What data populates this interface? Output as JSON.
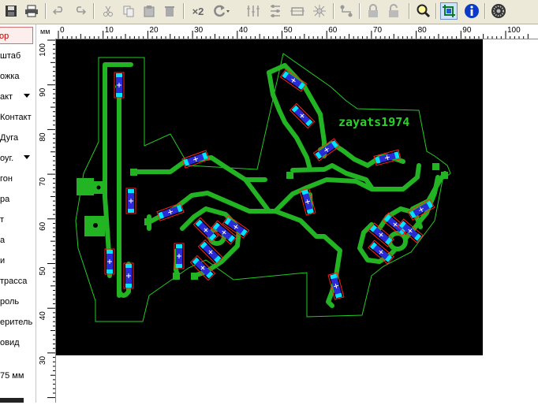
{
  "toolbar": {
    "icons": [
      "save-icon",
      "print-icon",
      "undo-icon",
      "redo-icon",
      "cut-icon",
      "copy-icon",
      "paste-icon",
      "delete-icon",
      "multiply-icon",
      "rotate-icon",
      "mirror-icon",
      "align-icon",
      "group-icon",
      "snap-icon",
      "route-icon",
      "lock-icon",
      "unlock-icon",
      "zoom-icon",
      "connections-icon",
      "info-icon",
      "gear-icon"
    ],
    "multiply_label": "×2"
  },
  "sidebar": {
    "items": [
      {
        "label": "ор",
        "selected": true
      },
      {
        "label": "штаб"
      },
      {
        "label": "ожка"
      },
      {
        "label": "акт",
        "dropdown": true
      },
      {
        "label": "Контакт"
      },
      {
        "label": "Дуга"
      },
      {
        "label": "оуг.",
        "dropdown": true
      },
      {
        "label": "гон"
      },
      {
        "label": "ра"
      },
      {
        "label": "т"
      },
      {
        "label": "а"
      },
      {
        "label": "и"
      },
      {
        "label": "трасса"
      },
      {
        "label": "роль"
      },
      {
        "label": "еритель"
      },
      {
        "label": "овид"
      }
    ],
    "measure": "75 мм"
  },
  "ruler": {
    "unit": "мм",
    "h_ticks": [
      "0",
      "10",
      "20",
      "30",
      "40",
      "50",
      "60",
      "70",
      "80",
      "90",
      "100"
    ],
    "v_ticks": [
      "100",
      "90",
      "80",
      "70",
      "60",
      "50",
      "40",
      "30"
    ]
  },
  "board": {
    "text": "zayats1974",
    "colors": {
      "background": "#000000",
      "track": "#22b422",
      "outline": "#22cc22",
      "pad_blue": "#2a2ad6",
      "pad_cyan": "#00e5ff",
      "part_outline": "#ff2020",
      "text": "#2ccf2c"
    }
  }
}
